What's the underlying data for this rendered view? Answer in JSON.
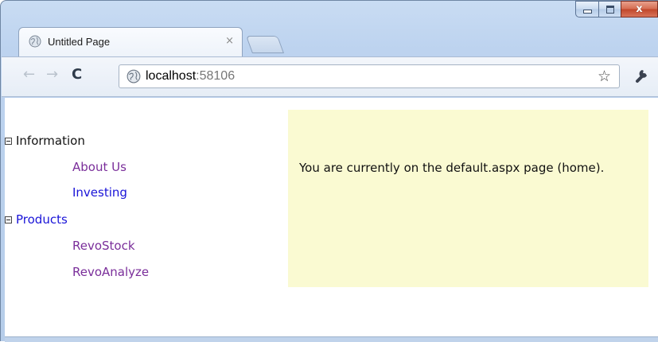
{
  "browser": {
    "tab_title": "Untitled Page",
    "tab_close": "×",
    "url_host": "localhost",
    "url_port": ":58106",
    "nav": {
      "back_icon": "←",
      "forward_icon": "→",
      "reload_icon": "C"
    },
    "bookmark_star": "☆",
    "window_close": "x"
  },
  "tree": {
    "nodes": [
      {
        "label": "Information",
        "expanded": true,
        "children": [
          {
            "label": "About Us"
          },
          {
            "label": "Investing"
          }
        ]
      },
      {
        "label": "Products",
        "expanded": true,
        "children": [
          {
            "label": "RevoStock"
          },
          {
            "label": "RevoAnalyze"
          }
        ]
      }
    ]
  },
  "content": {
    "text": "You are currently on the default.aspx page (home)."
  },
  "colors": {
    "content_background": "#fafad2",
    "link": "#1a14d8",
    "visited_link": "#7a2e9a"
  }
}
